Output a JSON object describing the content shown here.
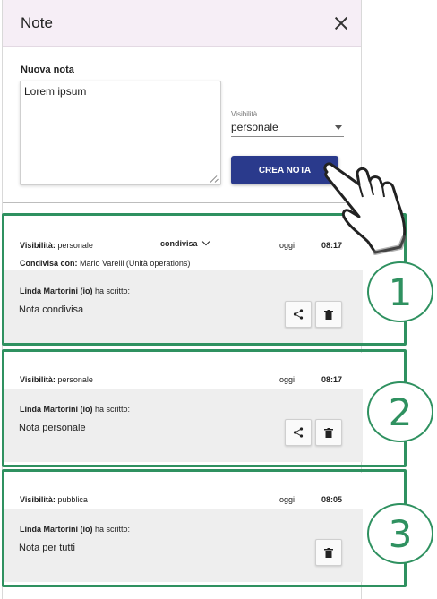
{
  "panel": {
    "title": "Note",
    "new_note_label": "Nuova nota",
    "textarea_value": "Lorem ipsum",
    "visibility_label": "Visibilità",
    "visibility_value": "personale",
    "create_button": "CREA NOTA"
  },
  "notes": [
    {
      "visibility_key": "Visibilità:",
      "visibility_value": "personale",
      "shared_dropdown": "condivisa",
      "date": "oggi",
      "time": "08:17",
      "shared_with_key": "Condivisa con:",
      "shared_with_value": "Mario Varelli (Unità operations)",
      "author": "Linda Martorini (io)",
      "wrote": "ha scritto:",
      "text": "Nota condivisa",
      "actions": [
        "share-icon",
        "trash-icon"
      ]
    },
    {
      "visibility_key": "Visibilità:",
      "visibility_value": "personale",
      "date": "oggi",
      "time": "08:17",
      "author": "Linda Martorini (io)",
      "wrote": "ha scritto:",
      "text": "Nota personale",
      "actions": [
        "share-icon",
        "trash-icon"
      ]
    },
    {
      "visibility_key": "Visibilità:",
      "visibility_value": "pubblica",
      "date": "oggi",
      "time": "08:05",
      "author": "Linda Martorini (io)",
      "wrote": "ha scritto:",
      "text": "Nota per tutti",
      "actions": [
        "trash-icon"
      ]
    }
  ],
  "annotations": [
    "1",
    "2",
    "3"
  ],
  "colors": {
    "header_bg": "#f6eef6",
    "primary_button": "#2a3a8c",
    "annotation_green": "#2f9160",
    "note_body_bg": "#eeeeee"
  }
}
